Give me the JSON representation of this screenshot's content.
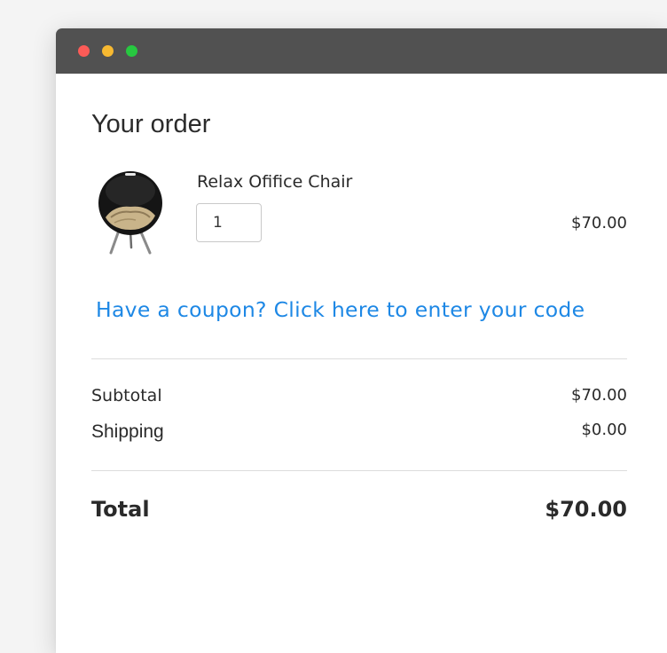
{
  "order": {
    "heading": "Your order",
    "item": {
      "name": "Relax Ofifice Chair",
      "quantity": "1",
      "price": "$70.00",
      "image_icon": "bowl-chair-image"
    },
    "coupon_link": "Have a coupon? Click here to enter your code",
    "subtotal_label": "Subtotal",
    "subtotal_value": "$70.00",
    "shipping_label": "Shipping",
    "shipping_value": "$0.00",
    "total_label": "Total",
    "total_value": "$70.00"
  },
  "colors": {
    "titlebar": "#515151",
    "link": "#1e88e5",
    "text": "#2a2a2a",
    "close": "#fc5b57",
    "minimize": "#f7b931",
    "maximize": "#27c840"
  }
}
